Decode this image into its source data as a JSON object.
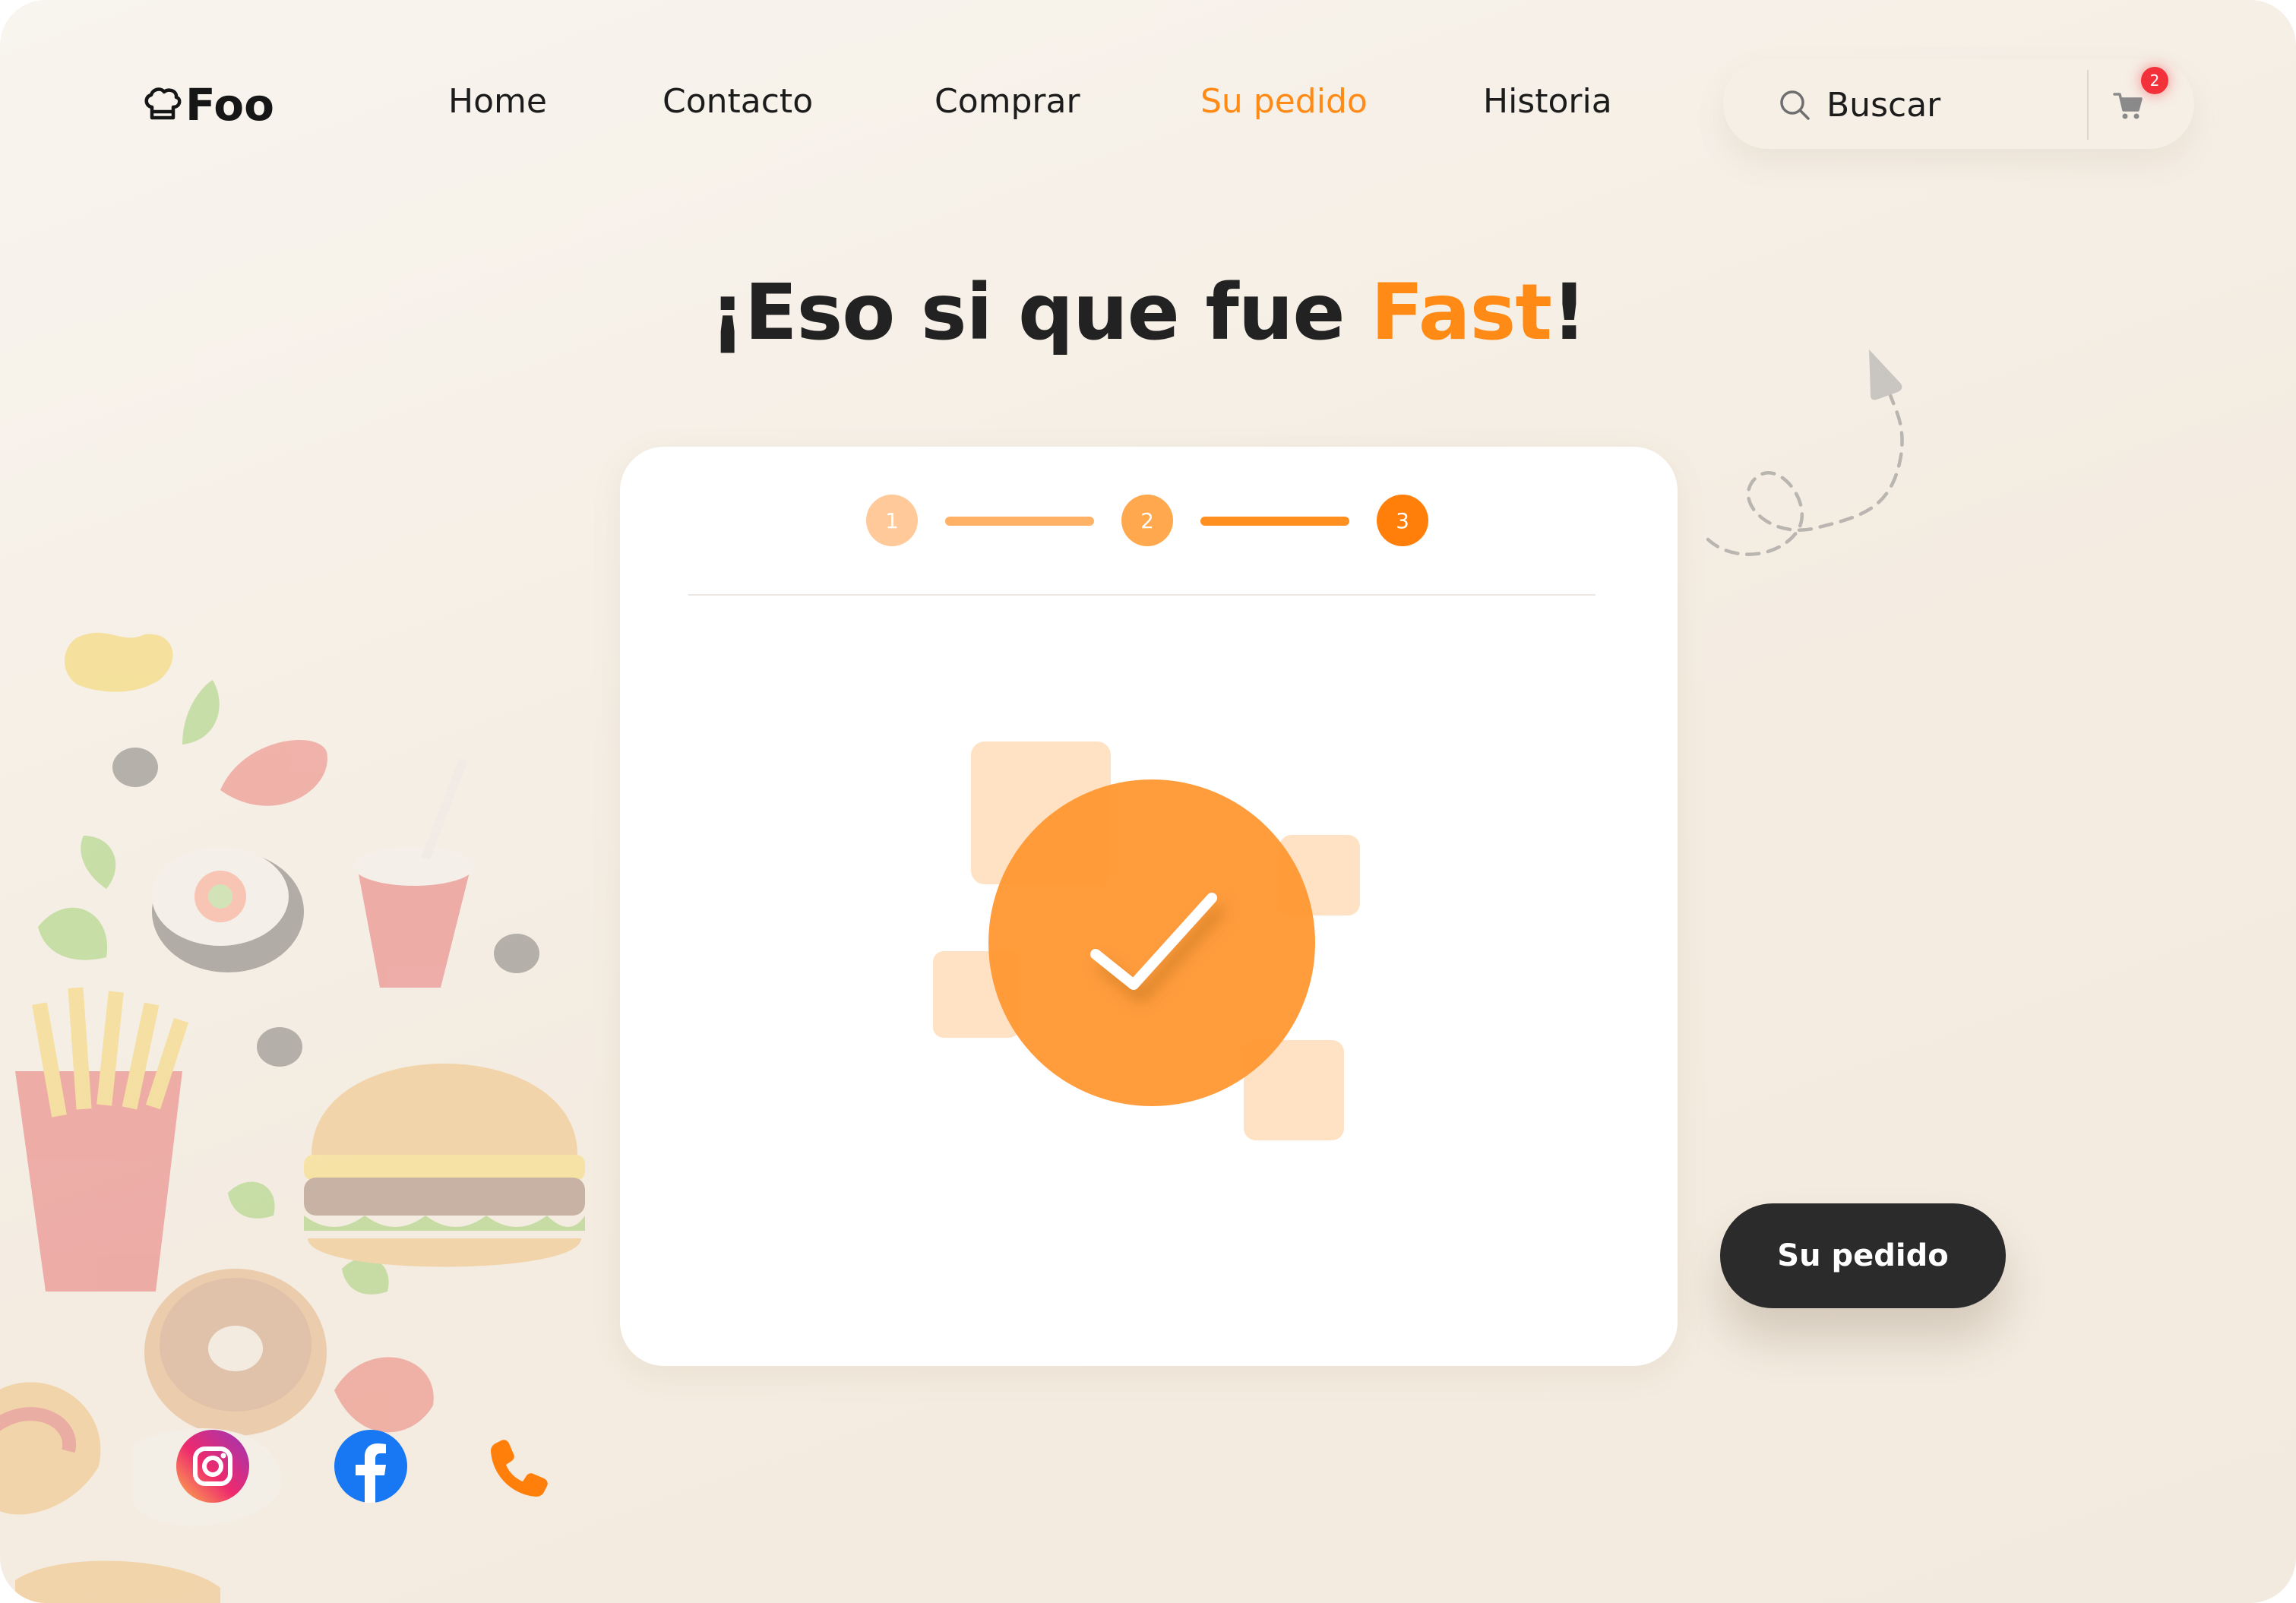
{
  "header": {
    "logo_text": "Foo",
    "logo_icon": "chef-hat-icon",
    "nav": [
      {
        "label": "Home",
        "active": false
      },
      {
        "label": "Contacto",
        "active": false
      },
      {
        "label": "Comprar",
        "active": false
      },
      {
        "label": "Su pedido",
        "active": true
      },
      {
        "label": "Historia",
        "active": false
      }
    ],
    "search": {
      "placeholder": "Buscar",
      "value": ""
    },
    "cart": {
      "icon": "cart-icon",
      "badge_count": "2"
    }
  },
  "headline": {
    "prefix": "¡Eso si que fue ",
    "accent": "Fast",
    "suffix": "!"
  },
  "card": {
    "steps": [
      {
        "label": "1",
        "state": "done"
      },
      {
        "label": "2",
        "state": "done"
      },
      {
        "label": "3",
        "state": "current"
      }
    ],
    "status_icon": "check-circle-icon"
  },
  "order_button": {
    "label": "Su pedido"
  },
  "social": [
    {
      "name": "instagram",
      "icon": "instagram-icon"
    },
    {
      "name": "facebook",
      "icon": "facebook-icon"
    },
    {
      "name": "phone",
      "icon": "phone-icon"
    }
  ],
  "colors": {
    "accent": "#ff8a15",
    "accent_light": "#ffc99a",
    "dark": "#2b2b2b",
    "badge": "#f2313a",
    "background": "#f4ece1"
  }
}
